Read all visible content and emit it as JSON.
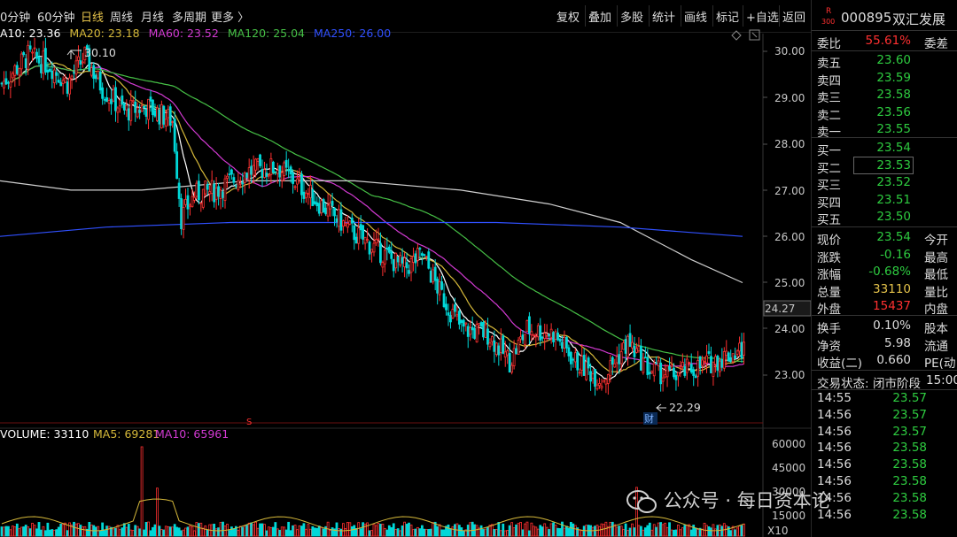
{
  "periods": [
    "0分钟",
    "60分钟",
    "日线",
    "周线",
    "月线",
    "多周期",
    "更多 〉"
  ],
  "active_period": "日线",
  "toolbar": [
    "复权",
    "叠加",
    "多股",
    "统计",
    "画线",
    "标记",
    "+自选",
    "返回"
  ],
  "ma_legend": [
    {
      "text": "A10: 23.36",
      "color": "#ffffff"
    },
    {
      "text": "MA20: 23.18",
      "color": "#d6b93a"
    },
    {
      "text": "MA60: 23.52",
      "color": "#d23ad2"
    },
    {
      "text": "MA120: 25.04",
      "color": "#46c046"
    },
    {
      "text": "MA250: 26.00",
      "color": "#3050ff"
    }
  ],
  "price_axis": [
    "30.00",
    "29.00",
    "28.00",
    "27.00",
    "26.00",
    "25.00",
    "24.00",
    "23.00"
  ],
  "current_price_tag": "24.27",
  "annotations": {
    "high": "30.10",
    "low": "22.29",
    "finance_mark": "财",
    "s_mark": "S"
  },
  "volume_legend": [
    {
      "text": "VOLUME: 33110",
      "color": "#ffffff"
    },
    {
      "text": "MA5: 69281",
      "color": "#d6b93a"
    },
    {
      "text": "MA10: 65961",
      "color": "#d23ad2"
    }
  ],
  "volume_axis": [
    "60000",
    "45000",
    "30000",
    "15000"
  ],
  "volume_unit": "X10",
  "stock": {
    "code": "000895",
    "name": "双汇发展",
    "badge_top": "R",
    "badge_bottom": "300"
  },
  "order_ratio": {
    "label": "委比",
    "value": "55.61%",
    "right": "委差"
  },
  "asks": [
    {
      "label": "卖五",
      "price": "23.60"
    },
    {
      "label": "卖四",
      "price": "23.59"
    },
    {
      "label": "卖三",
      "price": "23.58"
    },
    {
      "label": "卖二",
      "price": "23.56"
    },
    {
      "label": "卖一",
      "price": "23.55"
    }
  ],
  "bids": [
    {
      "label": "买一",
      "price": "23.54"
    },
    {
      "label": "买二",
      "price": "23.53"
    },
    {
      "label": "买三",
      "price": "23.52"
    },
    {
      "label": "买四",
      "price": "23.51"
    },
    {
      "label": "买五",
      "price": "23.50"
    }
  ],
  "quote": [
    {
      "label": "现价",
      "value": "23.54",
      "right": "今开",
      "color": "#2ecc40"
    },
    {
      "label": "涨跌",
      "value": "-0.16",
      "right": "最高",
      "color": "#2ecc40"
    },
    {
      "label": "涨幅",
      "value": "-0.68%",
      "right": "最低",
      "color": "#2ecc40"
    },
    {
      "label": "总量",
      "value": "33110",
      "right": "量比",
      "color": "#e5c34b"
    },
    {
      "label": "外盘",
      "value": "15437",
      "right": "内盘",
      "color": "#ff3030"
    }
  ],
  "fundamentals": [
    {
      "label": "换手",
      "value": "0.10%",
      "right": "股本"
    },
    {
      "label": "净资",
      "value": "5.98",
      "right": "流通"
    },
    {
      "label": "收益(二)",
      "value": "0.660",
      "right": "PE(动"
    }
  ],
  "trading_status": {
    "label": "交易状态:",
    "value": "闭市阶段",
    "time": "15:00"
  },
  "ticks": [
    {
      "time": "14:55",
      "price": "23.57"
    },
    {
      "time": "14:56",
      "price": "23.57"
    },
    {
      "time": "14:56",
      "price": "23.57"
    },
    {
      "time": "14:56",
      "price": "23.58"
    },
    {
      "time": "14:56",
      "price": "23.58"
    },
    {
      "time": "14:56",
      "price": "23.58"
    },
    {
      "time": "14:56",
      "price": "23.58"
    },
    {
      "time": "14:56",
      "price": "23.58"
    }
  ],
  "watermark": "公众号 · 每日资本论",
  "colors": {
    "up": "#ff3030",
    "down": "#00d8d8",
    "ma10": "#ffffff",
    "ma20": "#d6b93a",
    "ma60": "#d23ad2",
    "ma120": "#46c046",
    "ma250": "#3050ff",
    "ma_extra": "#cfcfcf"
  }
}
